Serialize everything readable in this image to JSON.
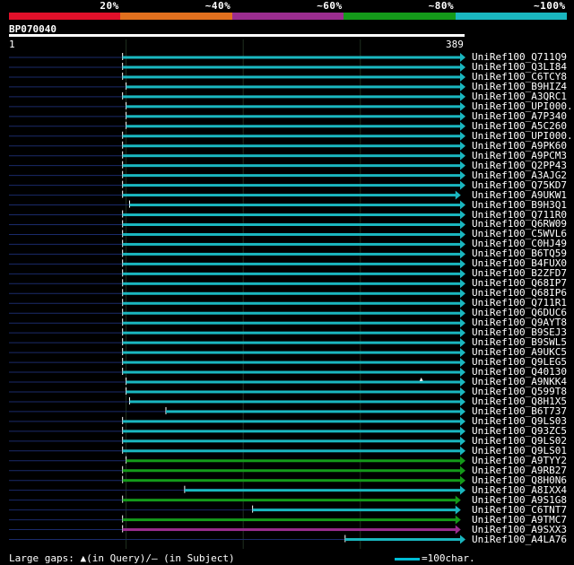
{
  "legend": {
    "segments": [
      {
        "label": "20%",
        "color": "#e0102a"
      },
      {
        "label": "~40%",
        "color": "#e2701e"
      },
      {
        "label": "~60%",
        "color": "#9b2d8f"
      },
      {
        "label": "~80%",
        "color": "#149a1a"
      },
      {
        "label": "~100%",
        "color": "#1ab7c0"
      }
    ]
  },
  "query": {
    "id": "BP070040",
    "start": "1",
    "end": "389"
  },
  "hits": [
    {
      "name": "UniRef100_Q711Q9",
      "start": 97,
      "end": 389,
      "color": "#1ab7c0",
      "gaps": []
    },
    {
      "name": "UniRef100_Q3LI84",
      "start": 97,
      "end": 389,
      "color": "#1ab7c0",
      "gaps": []
    },
    {
      "name": "UniRef100_C6TCY8",
      "start": 97,
      "end": 389,
      "color": "#1ab7c0",
      "gaps": []
    },
    {
      "name": "UniRef100_B9HIZ4",
      "start": 100,
      "end": 389,
      "color": "#1ab7c0",
      "gaps": []
    },
    {
      "name": "UniRef100_A3QRC1",
      "start": 97,
      "end": 389,
      "color": "#1ab7c0",
      "gaps": []
    },
    {
      "name": "UniRef100_UPI000..",
      "start": 100,
      "end": 389,
      "color": "#1ab7c0",
      "gaps": []
    },
    {
      "name": "UniRef100_A7P340",
      "start": 100,
      "end": 389,
      "color": "#1ab7c0",
      "gaps": []
    },
    {
      "name": "UniRef100_A5C260",
      "start": 100,
      "end": 389,
      "color": "#1ab7c0",
      "gaps": []
    },
    {
      "name": "UniRef100_UPI000..",
      "start": 97,
      "end": 389,
      "color": "#1ab7c0",
      "gaps": []
    },
    {
      "name": "UniRef100_A9PK60",
      "start": 97,
      "end": 389,
      "color": "#1ab7c0",
      "gaps": []
    },
    {
      "name": "UniRef100_A9PCM3",
      "start": 97,
      "end": 389,
      "color": "#1ab7c0",
      "gaps": []
    },
    {
      "name": "UniRef100_Q2PP43",
      "start": 97,
      "end": 389,
      "color": "#1ab7c0",
      "gaps": []
    },
    {
      "name": "UniRef100_A3AJG2",
      "start": 97,
      "end": 389,
      "color": "#1ab7c0",
      "gaps": []
    },
    {
      "name": "UniRef100_Q75KD7",
      "start": 97,
      "end": 389,
      "color": "#1ab7c0",
      "gaps": []
    },
    {
      "name": "UniRef100_A9UKW1",
      "start": 97,
      "end": 385,
      "color": "#1ab7c0",
      "gaps": []
    },
    {
      "name": "UniRef100_B9H3Q1",
      "start": 103,
      "end": 389,
      "color": "#1ab7c0",
      "gaps": []
    },
    {
      "name": "UniRef100_Q711R0",
      "start": 97,
      "end": 389,
      "color": "#1ab7c0",
      "gaps": []
    },
    {
      "name": "UniRef100_Q6RW09",
      "start": 97,
      "end": 389,
      "color": "#1ab7c0",
      "gaps": []
    },
    {
      "name": "UniRef100_C5WVL6",
      "start": 97,
      "end": 389,
      "color": "#1ab7c0",
      "gaps": []
    },
    {
      "name": "UniRef100_C0HJ49",
      "start": 97,
      "end": 389,
      "color": "#1ab7c0",
      "gaps": []
    },
    {
      "name": "UniRef100_B6TQ59",
      "start": 97,
      "end": 389,
      "color": "#1ab7c0",
      "gaps": []
    },
    {
      "name": "UniRef100_B4FUX0",
      "start": 97,
      "end": 389,
      "color": "#1ab7c0",
      "gaps": []
    },
    {
      "name": "UniRef100_B2ZFD7",
      "start": 97,
      "end": 389,
      "color": "#1ab7c0",
      "gaps": []
    },
    {
      "name": "UniRef100_Q68IP7",
      "start": 97,
      "end": 389,
      "color": "#1ab7c0",
      "gaps": []
    },
    {
      "name": "UniRef100_Q68IP6",
      "start": 97,
      "end": 389,
      "color": "#1ab7c0",
      "gaps": []
    },
    {
      "name": "UniRef100_Q711R1",
      "start": 97,
      "end": 389,
      "color": "#1ab7c0",
      "gaps": []
    },
    {
      "name": "UniRef100_Q6DUC6",
      "start": 97,
      "end": 389,
      "color": "#1ab7c0",
      "gaps": []
    },
    {
      "name": "UniRef100_Q9AYT8",
      "start": 97,
      "end": 389,
      "color": "#1ab7c0",
      "gaps": []
    },
    {
      "name": "UniRef100_B9SEJ3",
      "start": 97,
      "end": 389,
      "color": "#1ab7c0",
      "gaps": []
    },
    {
      "name": "UniRef100_B9SWL5",
      "start": 97,
      "end": 389,
      "color": "#1ab7c0",
      "gaps": []
    },
    {
      "name": "UniRef100_A9UKC5",
      "start": 97,
      "end": 389,
      "color": "#1ab7c0",
      "gaps": []
    },
    {
      "name": "UniRef100_Q9LEG5",
      "start": 97,
      "end": 389,
      "color": "#1ab7c0",
      "gaps": []
    },
    {
      "name": "UniRef100_Q40130",
      "start": 97,
      "end": 389,
      "color": "#1ab7c0",
      "gaps": []
    },
    {
      "name": "UniRef100_A9NKK4",
      "start": 100,
      "end": 389,
      "color": "#1ab7c0",
      "gaps": [
        352
      ]
    },
    {
      "name": "UniRef100_Q599T8",
      "start": 100,
      "end": 389,
      "color": "#1ab7c0",
      "gaps": []
    },
    {
      "name": "UniRef100_Q8H1X5",
      "start": 103,
      "end": 389,
      "color": "#1ab7c0",
      "gaps": []
    },
    {
      "name": "UniRef100_B6T737",
      "start": 134,
      "end": 389,
      "color": "#1ab7c0",
      "gaps": []
    },
    {
      "name": "UniRef100_Q9LS03",
      "start": 97,
      "end": 389,
      "color": "#1ab7c0",
      "gaps": []
    },
    {
      "name": "UniRef100_Q93ZC5",
      "start": 97,
      "end": 389,
      "color": "#1ab7c0",
      "gaps": []
    },
    {
      "name": "UniRef100_Q9LS02",
      "start": 97,
      "end": 389,
      "color": "#1ab7c0",
      "gaps": []
    },
    {
      "name": "UniRef100_Q9LS01",
      "start": 97,
      "end": 389,
      "color": "#1ab7c0",
      "gaps": []
    },
    {
      "name": "UniRef100_A9TYY2",
      "start": 100,
      "end": 389,
      "color": "#149a1a",
      "gaps": []
    },
    {
      "name": "UniRef100_A9RB27",
      "start": 97,
      "end": 389,
      "color": "#149a1a",
      "gaps": []
    },
    {
      "name": "UniRef100_Q8H0N6",
      "start": 97,
      "end": 389,
      "color": "#149a1a",
      "gaps": []
    },
    {
      "name": "UniRef100_A8IXX4",
      "start": 150,
      "end": 389,
      "color": "#1ab7c0",
      "gaps": []
    },
    {
      "name": "UniRef100_A9S1G8",
      "start": 97,
      "end": 385,
      "color": "#149a1a",
      "gaps": []
    },
    {
      "name": "UniRef100_C6TNT7",
      "start": 208,
      "end": 385,
      "color": "#1ab7c0",
      "gaps": []
    },
    {
      "name": "UniRef100_A9TMC7",
      "start": 97,
      "end": 385,
      "color": "#149a1a",
      "gaps": []
    },
    {
      "name": "UniRef100_A9SXX3",
      "start": 97,
      "end": 385,
      "color": "#9b2d8f",
      "gaps": []
    },
    {
      "name": "UniRef100_A4LA76",
      "start": 287,
      "end": 389,
      "color": "#1ab7c0",
      "gaps": []
    }
  ],
  "footer": {
    "gaps_label": "Large gaps: ▲(in Query)/– (in Subject)",
    "scale_label": "=100char."
  }
}
